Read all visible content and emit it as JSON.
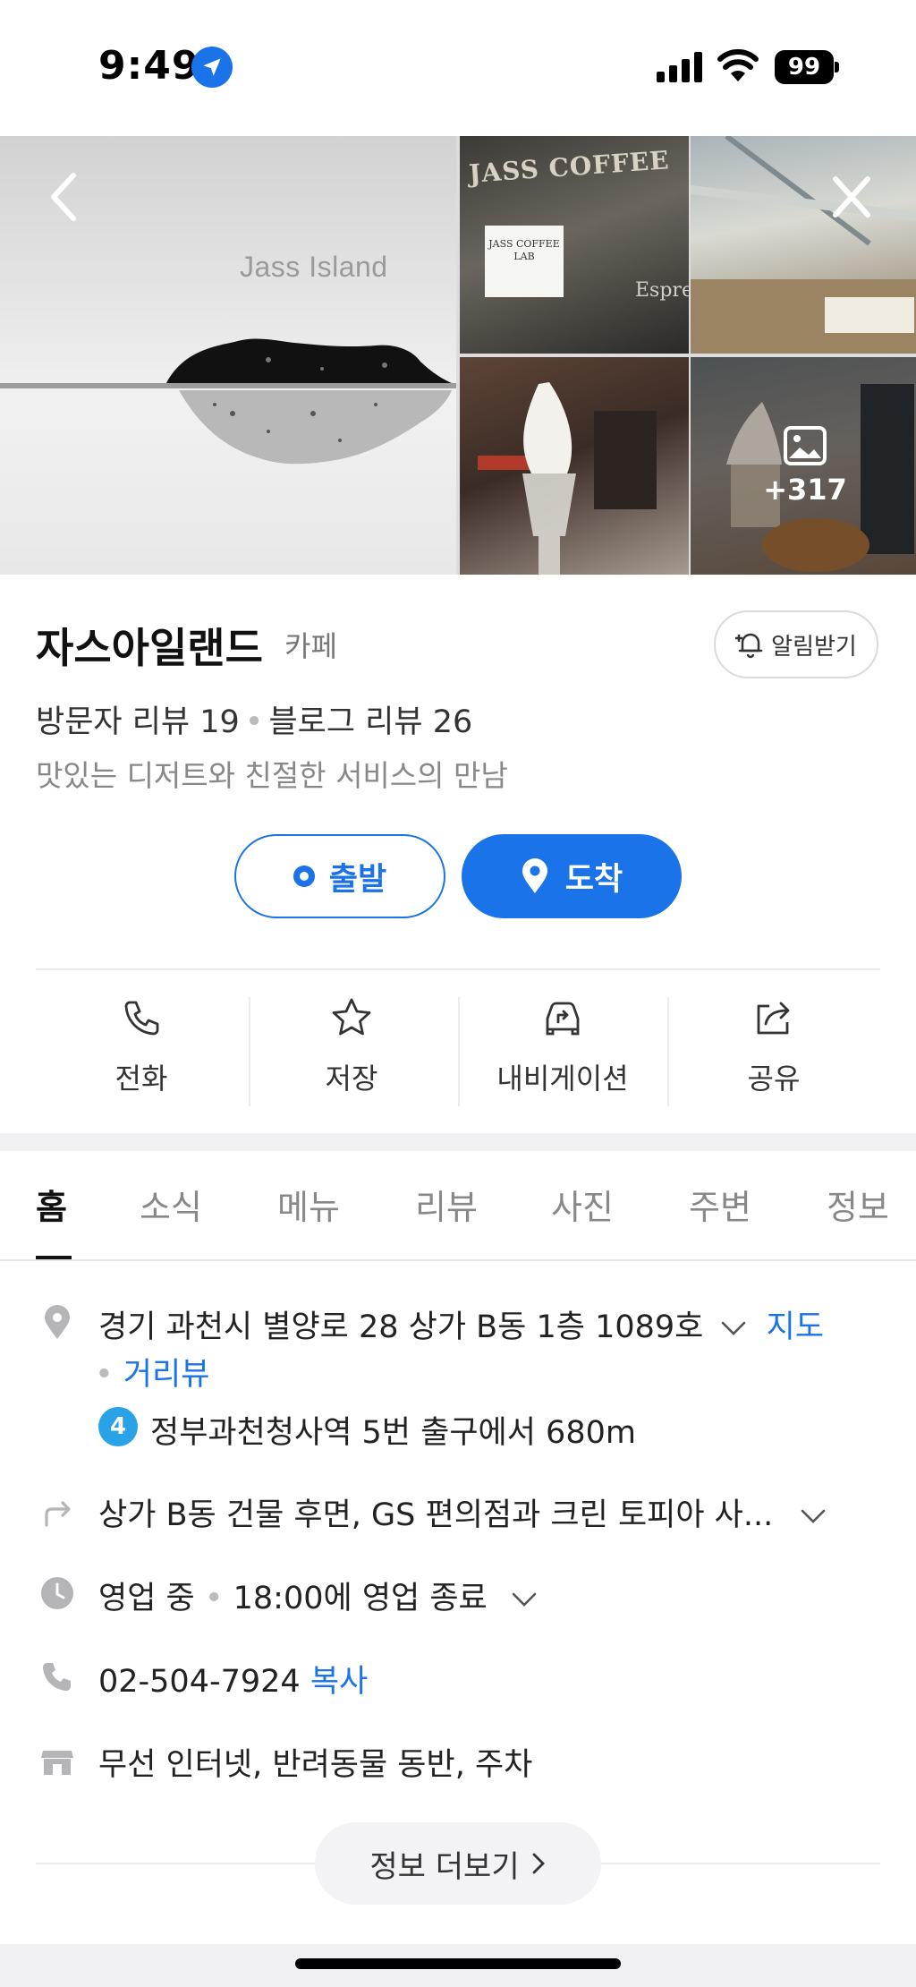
{
  "status_bar": {
    "time": "9:49",
    "battery": "99"
  },
  "gallery": {
    "main_brand": "Jass Island",
    "sign_text": "JASS COFFEE",
    "label_text": "JASS COFFEE LAB",
    "espresso_text": "Espre",
    "more_count": "+317"
  },
  "place": {
    "name": "자스아일랜드",
    "category": "카페",
    "notify_label": "알림받기",
    "visitor_reviews": "방문자 리뷰 19",
    "blog_reviews": "블로그 리뷰 26",
    "tagline": "맛있는 디저트와 친절한 서비스의 만남"
  },
  "route": {
    "depart_label": "출발",
    "arrive_label": "도착"
  },
  "actions": [
    {
      "label": "전화",
      "icon": "phone-icon"
    },
    {
      "label": "저장",
      "icon": "star-icon"
    },
    {
      "label": "내비게이션",
      "icon": "car-navigation-icon"
    },
    {
      "label": "공유",
      "icon": "share-icon"
    }
  ],
  "tabs": [
    "홈",
    "소식",
    "메뉴",
    "리뷰",
    "사진",
    "주변",
    "정보"
  ],
  "info": {
    "address": "경기 과천시 별양로 28 상가 B동 1층 1089호",
    "map_link": "지도",
    "street_view_link": "거리뷰",
    "subway_line": "4",
    "subway_text": "정부과천청사역 5번 출구에서 680m",
    "directions": "상가 B동 건물 후면, GS 편의점과 크린 토피아 사...",
    "open_status": "영업 중",
    "close_time": "18:00에 영업 종료",
    "phone": "02-504-7924",
    "copy_label": "복사",
    "amenities": "무선 인터넷, 반려동물 동반, 주차",
    "more_info_label": "정보 더보기"
  },
  "colors": {
    "accent": "#1a73e8",
    "subway_line_4": "#2aa2e8"
  }
}
